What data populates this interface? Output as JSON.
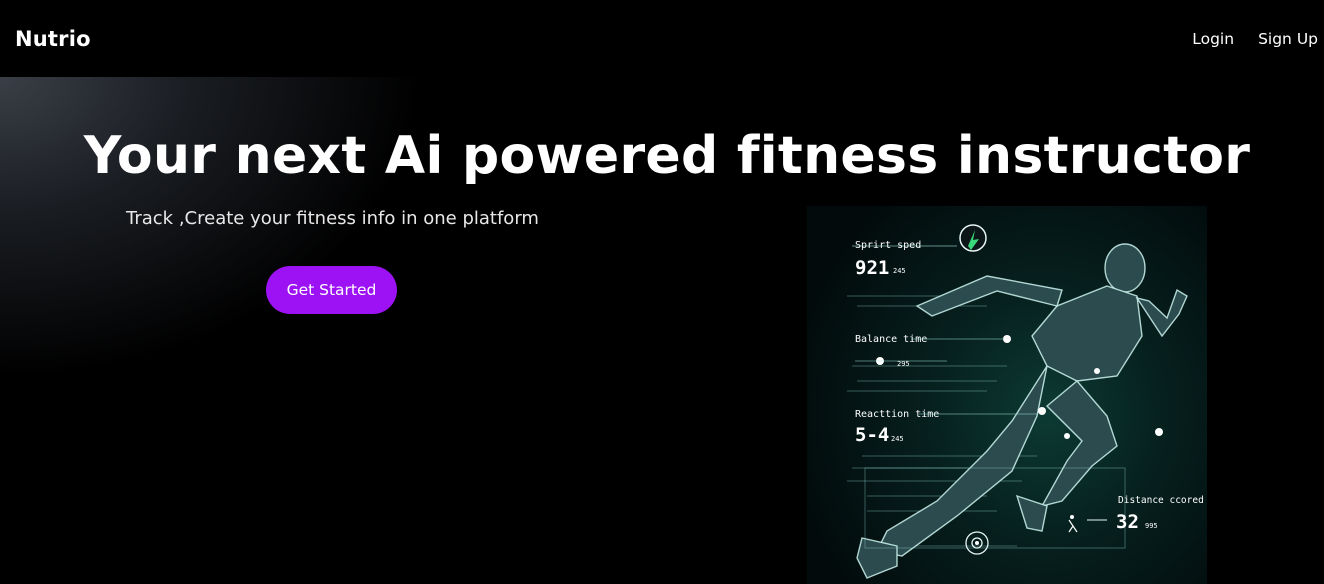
{
  "nav": {
    "brand": "Nutrio",
    "links": [
      {
        "label": "Login"
      },
      {
        "label": "Sign Up"
      }
    ]
  },
  "hero": {
    "title": "Your next Ai powered fitness instructor",
    "subtitle": "Track ,Create your fitness info in one platform",
    "cta_label": "Get Started",
    "cta_color": "#9c12f5"
  },
  "hero_image": {
    "stats": [
      {
        "label": "Sprirt sped",
        "value": "921",
        "unit": "245"
      },
      {
        "label": "Balance time",
        "value": "",
        "unit": "295"
      },
      {
        "label": "Reacttion time",
        "value": "5-4",
        "unit": "245"
      },
      {
        "label": "Distance ccored",
        "value": "32",
        "unit": "995"
      }
    ]
  }
}
